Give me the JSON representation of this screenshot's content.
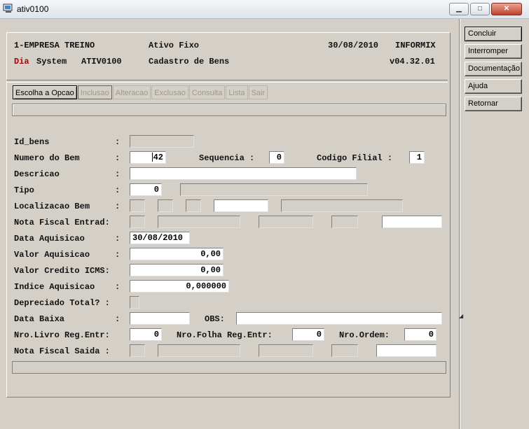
{
  "window": {
    "title": "ativ0100",
    "min_label": "▁",
    "max_label": "□",
    "close_label": "✕"
  },
  "header": {
    "company": "1-EMPRESA TREINO",
    "module": "Ativo Fixo",
    "date": "30/08/2010",
    "db": "INFORMIX",
    "day": "Dia",
    "system": "System",
    "program": "ATIV0100",
    "screen_title": "Cadastro de Bens",
    "version": "v04.32.01"
  },
  "menu": [
    "Escolha a Opcao",
    "Inclusao",
    "Alteracao",
    "Exclusao",
    "Consulta",
    "Lista",
    "Sair"
  ],
  "labels": {
    "id_bens": "Id_bens",
    "numero_bem": "Numero do Bem",
    "sequencia": "Sequencia :",
    "codigo_filial": "Codigo Filial :",
    "descricao": "Descricao",
    "tipo": "Tipo",
    "localizacao": "Localizacao Bem",
    "nota_entrada": "Nota Fiscal Entrad:",
    "data_aquisicao": "Data Aquisicao",
    "valor_aquisicao": "Valor Aquisicao",
    "valor_credito": "Valor Credito ICMS:",
    "indice_aquisicao": "Indice Aquisicao",
    "depreciado": "Depreciado Total? :",
    "data_baixa": "Data Baixa",
    "obs": "OBS:",
    "nro_livro": "Nro.Livro Reg.Entr:",
    "nro_folha": "Nro.Folha Reg.Entr:",
    "nro_ordem": "Nro.Ordem:",
    "nota_saida": "Nota Fiscal Saida :",
    "colon": ":"
  },
  "values": {
    "numero_bem": "42",
    "sequencia": "0",
    "codigo_filial": "1",
    "tipo": "0",
    "data_aquisicao": "30/08/2010",
    "valor_aquisicao": "0,00",
    "valor_credito": "0,00",
    "indice_aquisicao": "0,000000",
    "nro_livro": "0",
    "nro_folha": "0",
    "nro_ordem": "0"
  },
  "side_buttons": [
    "Concluir",
    "Interromper",
    "Documentação",
    "Ajuda",
    "Retornar"
  ]
}
